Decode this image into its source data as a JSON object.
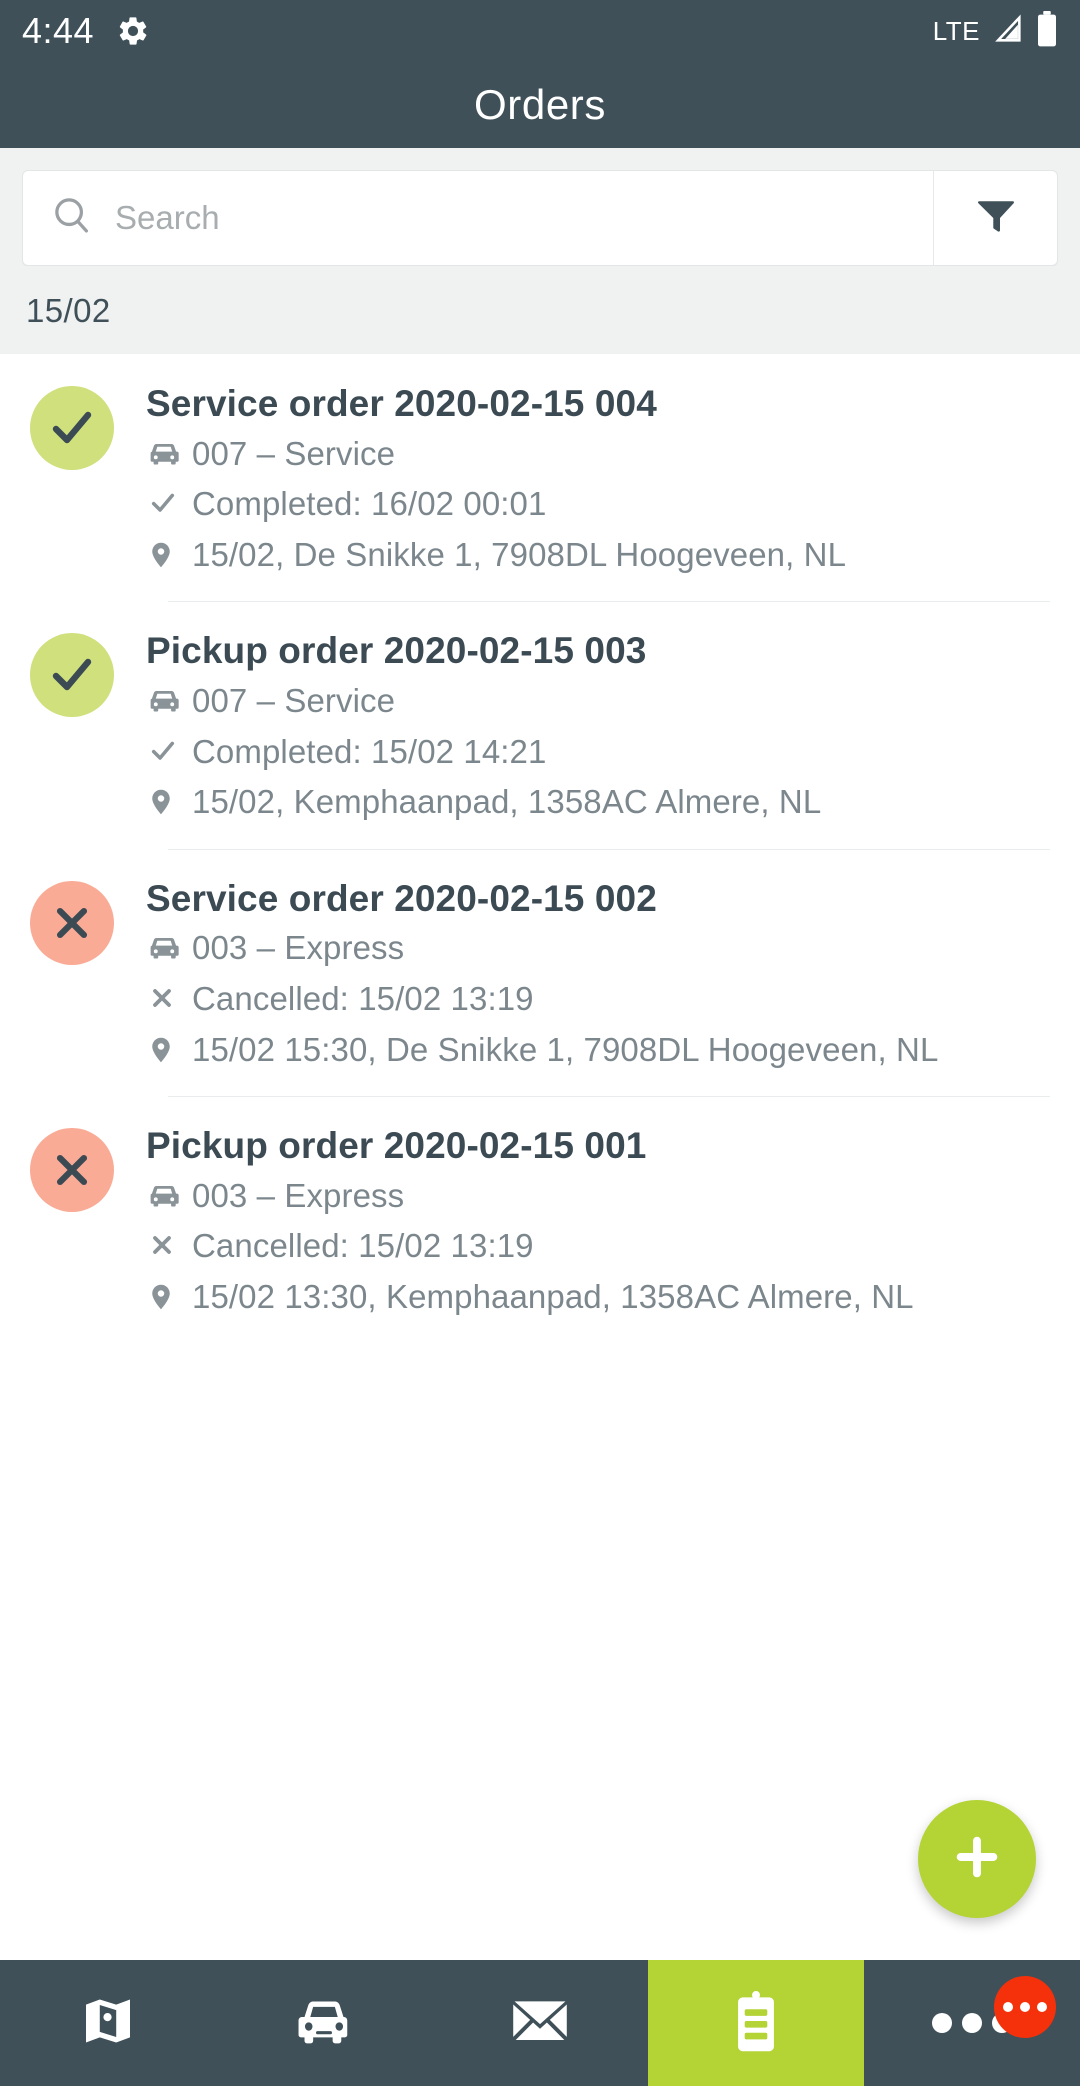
{
  "status_bar": {
    "time": "4:44",
    "gear_icon": "gear-icon",
    "network_label": "LTE",
    "signal_icon": "signal-icon",
    "battery_icon": "battery-icon"
  },
  "header": {
    "title": "Orders"
  },
  "search": {
    "placeholder": "Search",
    "value": "",
    "search_icon": "search-icon",
    "filter_icon": "filter-icon"
  },
  "date_group": {
    "label": "15/02"
  },
  "orders": [
    {
      "title": "Service order 2020-02-15 004",
      "status": "completed",
      "status_icon": "check-icon",
      "vehicle": "007 – Service",
      "vehicle_icon": "car-icon",
      "state_text": "Completed: 16/02 00:01",
      "state_icon": "check-icon",
      "location": "15/02, De Snikke 1, 7908DL Hoogeveen, NL",
      "location_icon": "map-pin-icon"
    },
    {
      "title": "Pickup order 2020-02-15 003",
      "status": "completed",
      "status_icon": "check-icon",
      "vehicle": "007 – Service",
      "vehicle_icon": "car-icon",
      "state_text": "Completed: 15/02 14:21",
      "state_icon": "check-icon",
      "location": "15/02, Kemphaanpad, 1358AC Almere, NL",
      "location_icon": "map-pin-icon"
    },
    {
      "title": "Service order 2020-02-15 002",
      "status": "cancelled",
      "status_icon": "cross-icon",
      "vehicle": "003 – Express",
      "vehicle_icon": "car-icon",
      "state_text": "Cancelled: 15/02 13:19",
      "state_icon": "cross-icon",
      "location": "15/02 15:30, De Snikke 1, 7908DL Hoogeveen, NL",
      "location_icon": "map-pin-icon"
    },
    {
      "title": "Pickup order 2020-02-15 001",
      "status": "cancelled",
      "status_icon": "cross-icon",
      "vehicle": "003 – Express",
      "vehicle_icon": "car-icon",
      "state_text": "Cancelled: 15/02 13:19",
      "state_icon": "cross-icon",
      "location": "15/02 13:30, Kemphaanpad, 1358AC Almere, NL",
      "location_icon": "map-pin-icon"
    }
  ],
  "fab": {
    "icon": "plus-icon",
    "label": "+"
  },
  "bottom_nav": {
    "items": [
      {
        "icon": "map-icon",
        "active": false
      },
      {
        "icon": "car-icon",
        "active": false
      },
      {
        "icon": "envelope-icon",
        "active": false
      },
      {
        "icon": "clipboard-icon",
        "active": true
      },
      {
        "icon": "more-dots-icon",
        "active": false
      }
    ],
    "badge_icon": "notification-badge-icon"
  },
  "colors": {
    "header_bg": "#3f5059",
    "accent_green": "#b4d335",
    "status_completed": "#cfe07c",
    "status_cancelled": "#f9ab96",
    "badge_red": "#f4310b",
    "page_bg": "#f0f2f2",
    "text_primary": "#3b4a53",
    "text_secondary": "#7c878d"
  }
}
